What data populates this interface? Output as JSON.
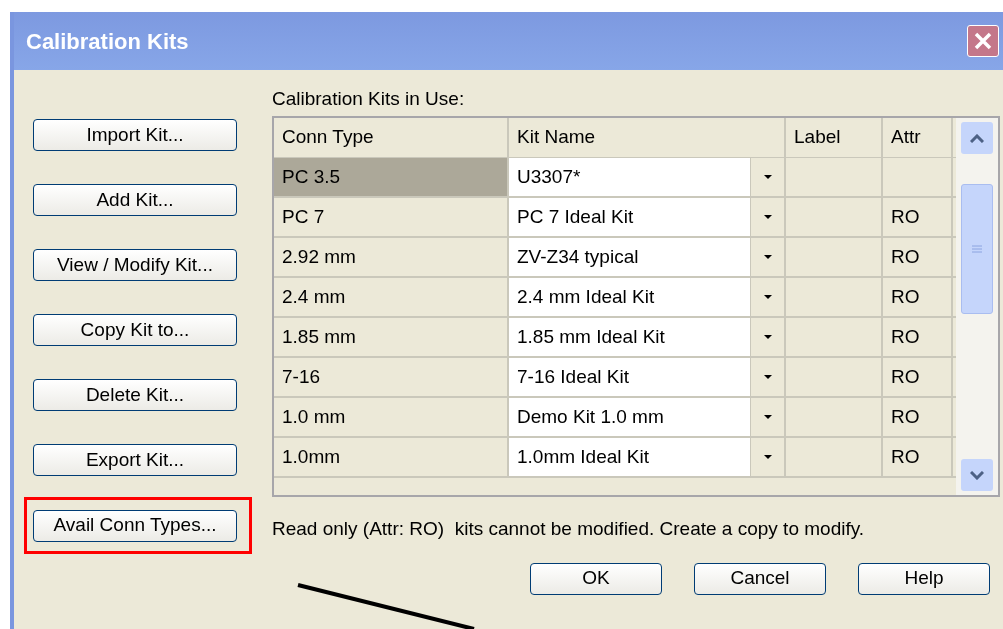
{
  "window": {
    "title": "Calibration Kits"
  },
  "side_buttons": [
    {
      "label": "Import Kit...",
      "highlighted": false
    },
    {
      "label": "Add Kit...",
      "highlighted": false
    },
    {
      "label": "View / Modify Kit...",
      "highlighted": false
    },
    {
      "label": "Copy Kit to...",
      "highlighted": false
    },
    {
      "label": "Delete Kit...",
      "highlighted": false
    },
    {
      "label": "Export Kit...",
      "highlighted": false
    },
    {
      "label": "Avail Conn Types...",
      "highlighted": true
    }
  ],
  "table": {
    "caption": "Calibration Kits in Use:",
    "columns": [
      "Conn Type",
      "Kit Name",
      "Label",
      "Attr"
    ],
    "rows": [
      {
        "conn_type": "PC 3.5",
        "kit_name": "U3307*",
        "attr": "",
        "selected": true
      },
      {
        "conn_type": "PC 7",
        "kit_name": "PC 7 Ideal Kit",
        "attr": "RO",
        "selected": false
      },
      {
        "conn_type": "2.92 mm",
        "kit_name": "ZV-Z34 typical",
        "attr": "RO",
        "selected": false
      },
      {
        "conn_type": "2.4 mm",
        "kit_name": "2.4 mm Ideal Kit",
        "attr": "RO",
        "selected": false
      },
      {
        "conn_type": "1.85 mm",
        "kit_name": "1.85 mm Ideal Kit",
        "attr": "RO",
        "selected": false
      },
      {
        "conn_type": "7-16",
        "kit_name": "7-16 Ideal Kit",
        "attr": "RO",
        "selected": false
      },
      {
        "conn_type": "1.0 mm",
        "kit_name": "Demo Kit 1.0 mm",
        "attr": "RO",
        "selected": false
      },
      {
        "conn_type": "1.0mm",
        "kit_name": "1.0mm Ideal Kit",
        "attr": "RO",
        "selected": false
      }
    ]
  },
  "note": "Read only (Attr: RO)  kits cannot be modified. Create a copy to modify.",
  "buttons": [
    "OK",
    "Cancel",
    "Help"
  ]
}
